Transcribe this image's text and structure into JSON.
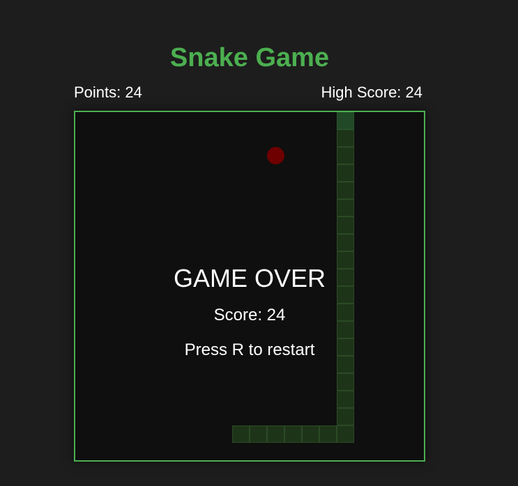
{
  "title": "Snake Game",
  "points_label": "Points: 24",
  "high_score_label": "High Score: 24",
  "game_over": {
    "title": "GAME OVER",
    "score_label": "Score: 24",
    "hint": "Press R to restart"
  },
  "colors": {
    "accent": "#4caf50",
    "background": "#1d1d1d",
    "board": "#0f0f0f",
    "snake": "#1e3419",
    "snake_head": "#214827",
    "food": "#6e0000"
  },
  "grid": {
    "cols": 20,
    "rows": 20
  },
  "snake": [
    [
      15,
      0
    ],
    [
      15,
      1
    ],
    [
      15,
      2
    ],
    [
      15,
      3
    ],
    [
      15,
      4
    ],
    [
      15,
      5
    ],
    [
      15,
      6
    ],
    [
      15,
      7
    ],
    [
      15,
      8
    ],
    [
      15,
      9
    ],
    [
      15,
      10
    ],
    [
      15,
      11
    ],
    [
      15,
      12
    ],
    [
      15,
      13
    ],
    [
      15,
      14
    ],
    [
      15,
      15
    ],
    [
      15,
      16
    ],
    [
      15,
      17
    ],
    [
      15,
      18
    ],
    [
      14,
      18
    ],
    [
      13,
      18
    ],
    [
      12,
      18
    ],
    [
      11,
      18
    ],
    [
      10,
      18
    ],
    [
      9,
      18
    ]
  ],
  "food": [
    11,
    2
  ]
}
